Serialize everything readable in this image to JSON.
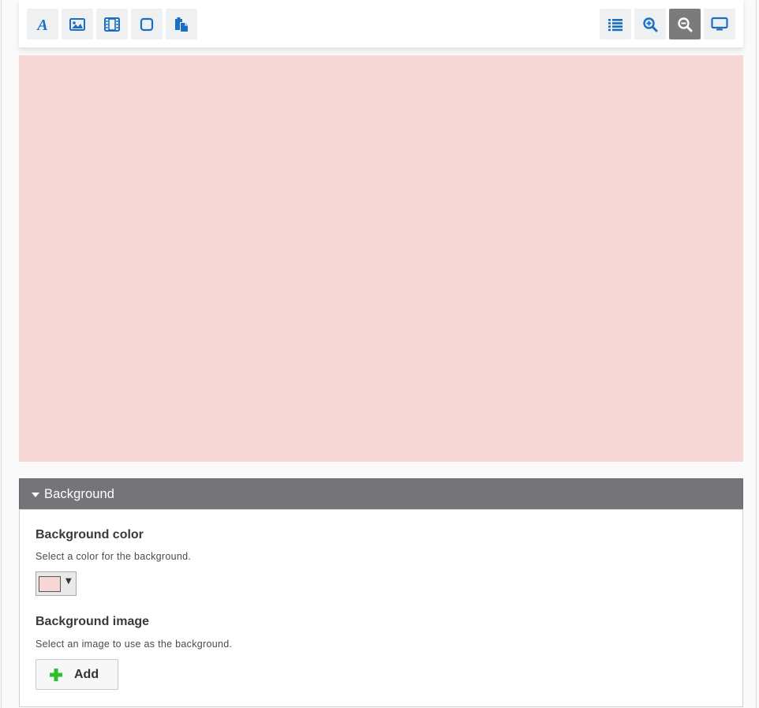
{
  "toolbar": {
    "left_tools": [
      {
        "name": "text-tool-button",
        "icon": "font-icon"
      },
      {
        "name": "image-tool-button",
        "icon": "image-icon"
      },
      {
        "name": "video-tool-button",
        "icon": "film-icon"
      },
      {
        "name": "shape-tool-button",
        "icon": "square-icon"
      },
      {
        "name": "paste-tool-button",
        "icon": "paste-icon"
      }
    ],
    "right_tools": [
      {
        "name": "list-view-button",
        "icon": "list-icon"
      },
      {
        "name": "zoom-in-button",
        "icon": "zoom-in-icon"
      },
      {
        "name": "zoom-out-button",
        "icon": "zoom-out-icon",
        "active": true
      },
      {
        "name": "preview-button",
        "icon": "desktop-icon"
      }
    ],
    "icon_color": "#1a6fc4",
    "active_icon_color": "#ffffff"
  },
  "canvas": {
    "background_color": "#f6d7d6"
  },
  "panel": {
    "title": "Background",
    "expanded": true
  },
  "background_color": {
    "label": "Background color",
    "description": "Select a color for the background.",
    "value": "#f6d7d6",
    "dropdown_icon": "▼"
  },
  "background_image": {
    "label": "Background image",
    "description": "Select an image to use as the background.",
    "add_label": "Add",
    "add_icon_color": "#2ebd2e"
  }
}
